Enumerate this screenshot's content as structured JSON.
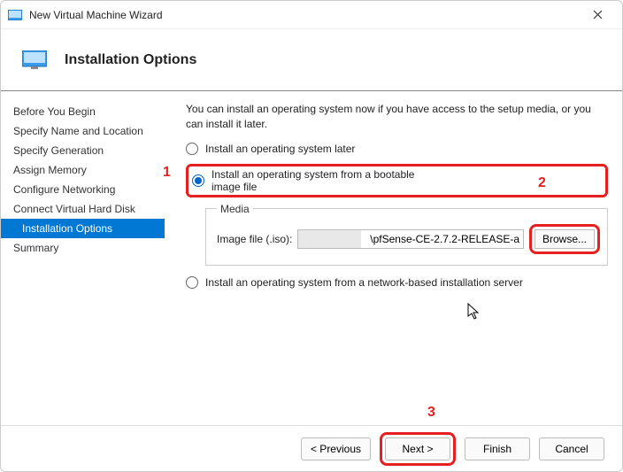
{
  "window": {
    "title": "New Virtual Machine Wizard"
  },
  "header": {
    "title": "Installation Options"
  },
  "sidebar": {
    "items": [
      {
        "label": "Before You Begin"
      },
      {
        "label": "Specify Name and Location"
      },
      {
        "label": "Specify Generation"
      },
      {
        "label": "Assign Memory"
      },
      {
        "label": "Configure Networking"
      },
      {
        "label": "Connect Virtual Hard Disk"
      },
      {
        "label": "Installation Options"
      },
      {
        "label": "Summary"
      }
    ],
    "selectedIndex": 6
  },
  "main": {
    "intro": "You can install an operating system now if you have access to the setup media, or you can install it later.",
    "options": {
      "later": "Install an operating system later",
      "bootable": "Install an operating system from a bootable image file",
      "network": "Install an operating system from a network-based installation server"
    },
    "media": {
      "legend": "Media",
      "label": "Image file (.iso):",
      "value": "\\pfSense-CE-2.7.2-RELEASE-a",
      "browse": "Browse..."
    }
  },
  "footer": {
    "previous": "< Previous",
    "next": "Next >",
    "finish": "Finish",
    "cancel": "Cancel"
  },
  "annotations": {
    "a1": "1",
    "a2": "2",
    "a3": "3"
  }
}
